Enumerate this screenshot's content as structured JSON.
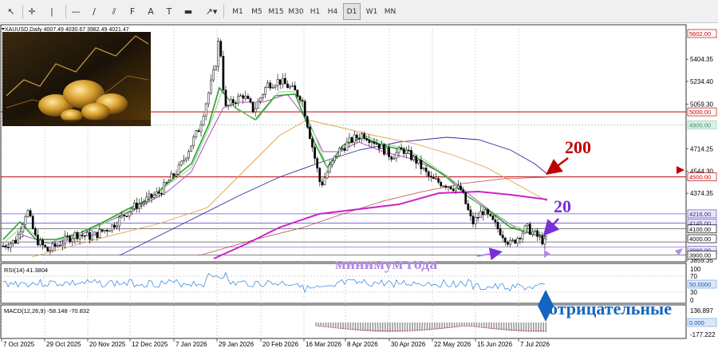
{
  "toolbar": {
    "tools": [
      {
        "name": "cursor-icon",
        "glyph": "↖"
      },
      {
        "name": "crosshair-icon",
        "glyph": "✛"
      },
      {
        "name": "vertical-line-icon",
        "glyph": "|"
      },
      {
        "name": "horizontal-line-icon",
        "glyph": "—"
      },
      {
        "name": "trendline-icon",
        "glyph": "∕"
      },
      {
        "name": "channel-icon",
        "glyph": "⫽"
      },
      {
        "name": "fibonacci-icon",
        "glyph": "F"
      },
      {
        "name": "text-icon",
        "glyph": "A"
      },
      {
        "name": "text-label-icon",
        "glyph": "T"
      },
      {
        "name": "rectangle-icon",
        "glyph": "▬"
      },
      {
        "name": "arrows-menu-icon",
        "glyph": "↗▾"
      }
    ],
    "timeframes": [
      "M1",
      "M5",
      "M15",
      "M30",
      "H1",
      "H4",
      "D1",
      "W1",
      "MN"
    ],
    "active_timeframe": "D1"
  },
  "chart": {
    "symbol_header": "XAUUSD,Daily  4007.49 4030.67 3982.49 4021.47",
    "price_ticks": [
      "5404.35",
      "5234.40",
      "5059.30",
      "4714.25",
      "4544.30",
      "4374.35",
      "3859.35"
    ],
    "price_tags": [
      {
        "value": "5602.00",
        "bg": "#ffffff",
        "fg": "#c00000",
        "border": "#c00000"
      },
      {
        "value": "5000.00",
        "bg": "#ffffff",
        "fg": "#c00000",
        "border": "#c00000"
      },
      {
        "value": "4900.00",
        "bg": "#d9f2e6",
        "fg": "#3a8a60",
        "border": "#8fd3b0"
      },
      {
        "value": "4500.00",
        "bg": "#ffffff",
        "fg": "#c00000",
        "border": "#c00000"
      },
      {
        "value": "4216.00",
        "bg": "#e8e3f8",
        "fg": "#3b2d88",
        "border": "#6a5acd"
      },
      {
        "value": "4145.00",
        "bg": "#e8e3f8",
        "fg": "#3b2d88",
        "border": "#6a5acd"
      },
      {
        "value": "4100.00",
        "bg": "#ffffff",
        "fg": "#000000",
        "border": "#000000"
      },
      {
        "value": "4000.00",
        "bg": "#ffffff",
        "fg": "#000000",
        "border": "#000000"
      },
      {
        "value": "3960.00",
        "bg": "#e8e3f8",
        "fg": "#3b2d88",
        "border": "#6a5acd"
      },
      {
        "value": "3900.00",
        "bg": "#ffffff",
        "fg": "#000000",
        "border": "#000000"
      }
    ],
    "annotations": {
      "label_200": "200",
      "label_20": "20",
      "year_low_text": "минимум года",
      "negative_text": "отрицательные"
    },
    "rsi": {
      "header": "RSI(14) 41.3804",
      "ticks": [
        "100",
        "70",
        "30",
        "0"
      ],
      "tag": "50.0000"
    },
    "macd": {
      "header": "MACD(12,26,9) -58.148 -70.832",
      "ticks": [
        "136.897",
        "-177.222"
      ],
      "tag": "0.000"
    },
    "dates": [
      "7 Oct 2025",
      "29 Oct 2025",
      "20 Nov 2025",
      "12 Dec 2025",
      "7 Jan 2026",
      "29 Jan 2026",
      "20 Feb 2026",
      "16 Mar 2026",
      "8 Apr 2026",
      "30 Apr 2026",
      "22 May 2026",
      "15 Jun 2026",
      "7 Jul 2026"
    ],
    "colors": {
      "annotation_red": "#c00000",
      "annotation_purple": "#7b2fd8",
      "annotation_blue": "#1565c0",
      "ma200": "#2c2f9a",
      "ma_magenta": "#cc22cc",
      "ma_orange": "#e0a050",
      "ma_green": "#2aa02a"
    }
  }
}
